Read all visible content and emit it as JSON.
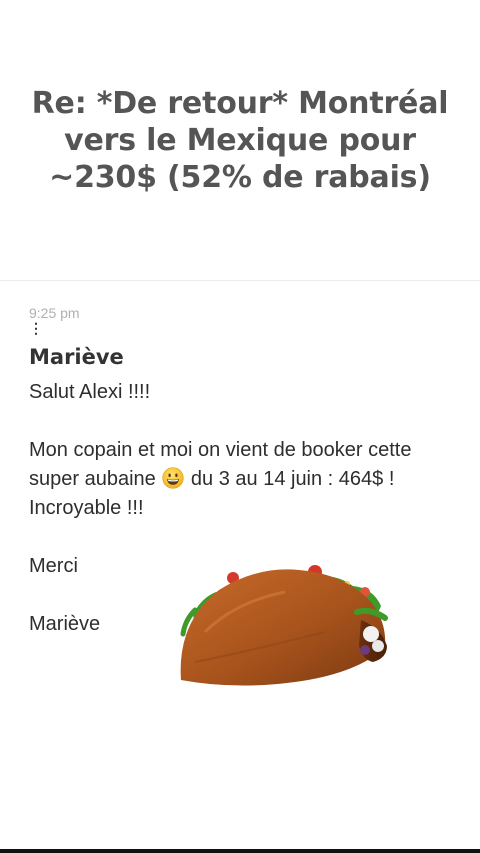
{
  "email": {
    "subject": "Re: *De retour* Montréal vers le Mexique pour ~230$ (52% de rabais)",
    "time": "9:25 pm",
    "sender": "Mariève",
    "body": {
      "greeting": "Salut Alexi !!!!",
      "line1_before_emoji": "Mon copain et moi on vient de booker cette super aubaine",
      "line1_after_emoji": "du 3 au 14 juin : 464$ ! Incroyable !!!",
      "thanks": "Merci",
      "signature": "Mariève"
    }
  },
  "icons": {
    "more": "vertical-ellipsis-icon",
    "emoji": "grinning-face-emoji",
    "sticker": "taco-sticker"
  }
}
